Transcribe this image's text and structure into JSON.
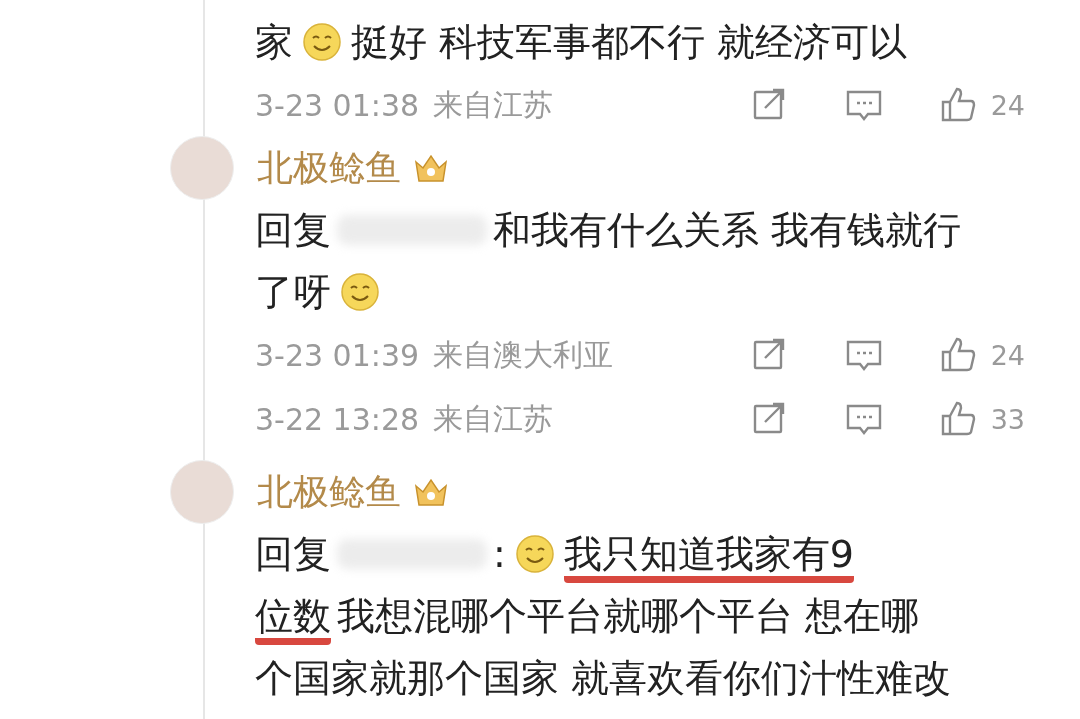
{
  "comments": [
    {
      "kind": "tail",
      "lines": [
        {
          "parts": [
            {
              "kind": "text",
              "text": "家",
              "underlined": false
            },
            {
              "kind": "emoji"
            },
            {
              "kind": "text",
              "text": "挺好 科技军事都不行 就经济可以",
              "underlined": false
            }
          ]
        }
      ],
      "meta": {
        "time": "3-23 01:38",
        "location": "来自江苏",
        "likes": "24"
      }
    },
    {
      "kind": "reply",
      "author": "北极鲶鱼",
      "lines": [
        {
          "parts": [
            {
              "kind": "text",
              "text": "回复",
              "underlined": false
            },
            {
              "kind": "blur"
            },
            {
              "kind": "text",
              "text": "和我有什么关系 我有钱就行",
              "underlined": false
            }
          ]
        },
        {
          "parts": [
            {
              "kind": "text",
              "text": "了呀",
              "underlined": false
            },
            {
              "kind": "emoji"
            }
          ]
        }
      ],
      "meta": {
        "time": "3-23 01:39",
        "location": "来自澳大利亚",
        "likes": "24"
      }
    },
    {
      "kind": "tail",
      "meta": {
        "time": "3-22 13:28",
        "location": "来自江苏",
        "likes": "33"
      }
    },
    {
      "kind": "reply",
      "author": "北极鲶鱼",
      "lines": [
        {
          "parts": [
            {
              "kind": "text",
              "text": "回复",
              "underlined": false
            },
            {
              "kind": "blur"
            },
            {
              "kind": "text",
              "text": ":",
              "underlined": false
            },
            {
              "kind": "emoji"
            },
            {
              "kind": "text",
              "text": "我只知道我家有9",
              "underlined": true
            }
          ]
        },
        {
          "parts": [
            {
              "kind": "text",
              "text": "位数",
              "underlined": true
            },
            {
              "kind": "text",
              "text": "我想混哪个平台就哪个平台 想在哪",
              "underlined": false
            }
          ]
        },
        {
          "parts": [
            {
              "kind": "text",
              "text": "个国家就那个国家 就喜欢看你们汁性难改",
              "underlined": false
            }
          ]
        }
      ]
    }
  ]
}
